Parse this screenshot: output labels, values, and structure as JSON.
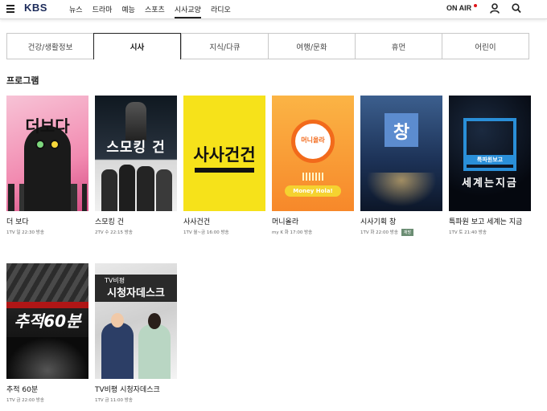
{
  "header": {
    "logo": "KBS",
    "nav": [
      "뉴스",
      "드라마",
      "예능",
      "스포츠",
      "시사교양",
      "라디오"
    ],
    "active_nav": "시사교양",
    "onair": "ON AIR"
  },
  "tabs": [
    "건강/생활정보",
    "시사",
    "지식/다큐",
    "여행/문화",
    "휴먼",
    "어린이"
  ],
  "active_tab": "시사",
  "section_title": "프로그램",
  "programs": [
    {
      "title": "더 보다",
      "schedule": "1TV 일 22:30 방송",
      "poster_text": "더보다"
    },
    {
      "title": "스모킹 건",
      "schedule": "2TV 수 22:15 방송",
      "poster_text": "스모킹 건"
    },
    {
      "title": "사사건건",
      "schedule": "1TV 월~금 16:00 방송",
      "poster_text": "사사건건"
    },
    {
      "title": "머니올라",
      "schedule": "my K 화 17:00 방송",
      "poster_text": "머니올라",
      "poster_sub": "Money Hola!"
    },
    {
      "title": "시사기획 창",
      "schedule": "1TV 화 22:00 방송",
      "badge": "재방",
      "poster_text": "창"
    },
    {
      "title": "특파원 보고 세계는 지금",
      "schedule": "1TV 토 21:40 방송",
      "poster_text": "세계는지금",
      "poster_sub": "특파원보고"
    },
    {
      "title": "추적 60분",
      "schedule": "1TV 금 22:00 방송",
      "poster_text": "추적60분"
    },
    {
      "title": "TV비평 시청자데스크",
      "schedule": "1TV 금 11:00 방송",
      "poster_text": "시청자데스크",
      "poster_sub": "TV비평"
    }
  ]
}
